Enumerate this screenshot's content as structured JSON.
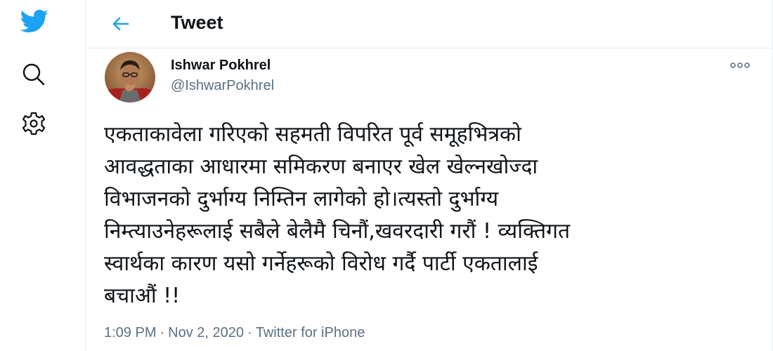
{
  "colors": {
    "brand_blue": "#1da1f2",
    "text_primary": "#0f1419",
    "text_secondary": "#5b7083",
    "border": "#e6ecf0"
  },
  "left_nav": {
    "items": [
      {
        "icon": "twitter-logo-icon"
      },
      {
        "icon": "search-icon"
      },
      {
        "icon": "gear-icon"
      }
    ]
  },
  "header": {
    "back_icon": "arrow-left-icon",
    "title": "Tweet"
  },
  "tweet": {
    "author": {
      "name": "Ishwar Pokhrel",
      "handle": "@IshwarPokhrel"
    },
    "more_icon": "more-horizontal-icon",
    "text_lines": [
      "एकताकावेला गरिएको सहमती विपरित पूर्व समूहभित्रको",
      "आवद्धताका आधारमा समिकरण बनाएर खेल खेल्नखोज्दा",
      "विभाजनको दुर्भाग्य निम्तिन लागेको हो।त्यस्तो दुर्भाग्य",
      "निम्त्याउनेहरूलाई सबैले बेलैमै चिनौं,खवरदारी गरौं ! व्यक्तिगत",
      "स्वार्थका कारण यसो गर्नेहरूको विरोध गर्दै पार्टी एकतालाई",
      "बचाऔं !!"
    ],
    "time": "1:09 PM",
    "separator": "·",
    "date": "Nov 2, 2020",
    "source": "Twitter for iPhone"
  }
}
